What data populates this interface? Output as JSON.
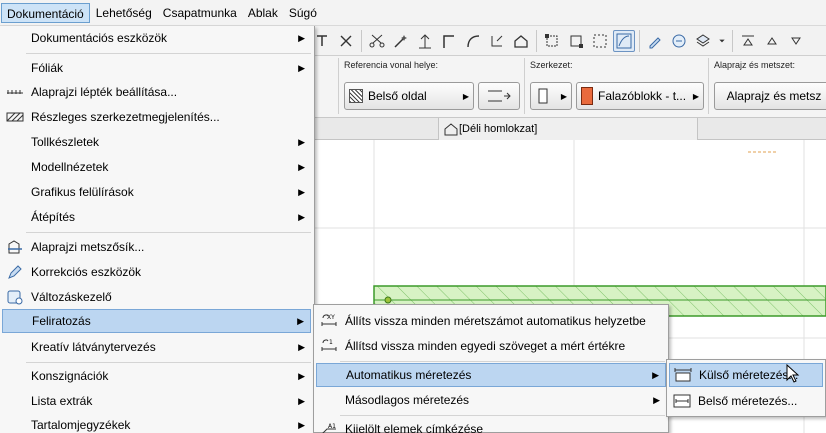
{
  "menubar": {
    "items": [
      {
        "label": "Dokumentáció",
        "active": true
      },
      {
        "label": "Lehetőség"
      },
      {
        "label": "Csapatmunka"
      },
      {
        "label": "Ablak"
      },
      {
        "label": "Súgó"
      }
    ]
  },
  "infobox": {
    "ref_title": "Referencia vonal helye:",
    "ref_value": "Belső oldal",
    "struct_title": "Szerkezet:",
    "struct_value": "Falazóblokk - t...",
    "plan_title": "Alaprajz és metszet:",
    "plan_value": "Alaprajz és metsz"
  },
  "tab": {
    "label": "[Déli homlokzat]"
  },
  "main_menu": {
    "items": [
      {
        "label": "Dokumentációs eszközök",
        "submenu": true,
        "icon": "none"
      },
      {
        "label": "Fóliák",
        "submenu": true,
        "icon": "none"
      },
      {
        "label": "Alaprajzi lépték beállítása...",
        "submenu": false,
        "icon": "scale-icon"
      },
      {
        "label": "Részleges szerkezetmegjelenítés...",
        "submenu": false,
        "icon": "hatch-icon"
      },
      {
        "label": "Tollkészletek",
        "submenu": true,
        "icon": "none"
      },
      {
        "label": "Modellnézetek",
        "submenu": true,
        "icon": "none"
      },
      {
        "label": "Grafikus felülírások",
        "submenu": true,
        "icon": "none"
      },
      {
        "label": "Átépítés",
        "submenu": true,
        "icon": "none"
      },
      {
        "label": "Alaprajzi metszősík...",
        "submenu": false,
        "icon": "floor-plan-cut-icon"
      },
      {
        "label": "Korrekciós eszközök",
        "submenu": false,
        "icon": "pencil-icon"
      },
      {
        "label": "Változáskezelő",
        "submenu": false,
        "icon": "change-manager-icon"
      },
      {
        "label": "Feliratozás",
        "submenu": true,
        "icon": "none",
        "highlighted": true
      },
      {
        "label": "Kreatív látványtervezés",
        "submenu": true,
        "icon": "none"
      },
      {
        "label": "Konszignációk",
        "submenu": true,
        "icon": "none"
      },
      {
        "label": "Lista extrák",
        "submenu": true,
        "icon": "none"
      },
      {
        "label": "Tartalomjegyzékek",
        "submenu": true,
        "icon": "none"
      }
    ]
  },
  "sub_menu_1": {
    "items": [
      {
        "label": "Állíts vissza minden méretszámot automatikus helyzetbe",
        "icon": "reset-dimension-text-icon"
      },
      {
        "label": "Állítsd vissza minden egyedi szöveget a mért értékre",
        "icon": "reset-custom-text-icon"
      },
      {
        "label": "Automatikus méretezés",
        "icon": "none",
        "submenu": true,
        "highlighted": true
      },
      {
        "label": "Másodlagos méretezés",
        "icon": "none",
        "submenu": true
      },
      {
        "label": "Kijelölt elemek címkézése",
        "icon": "label-icon"
      }
    ]
  },
  "sub_menu_2": {
    "items": [
      {
        "label": "Külső méretezés...",
        "icon": "exterior-dimension-icon",
        "highlighted": true
      },
      {
        "label": "Belső méretezés...",
        "icon": "interior-dimension-icon"
      }
    ]
  },
  "colors": {
    "highlight": "#bcd6f1",
    "wall_fill": "#d7f2c4",
    "wall_border": "#3c9a2a",
    "guide_orange": "#e0a050"
  }
}
